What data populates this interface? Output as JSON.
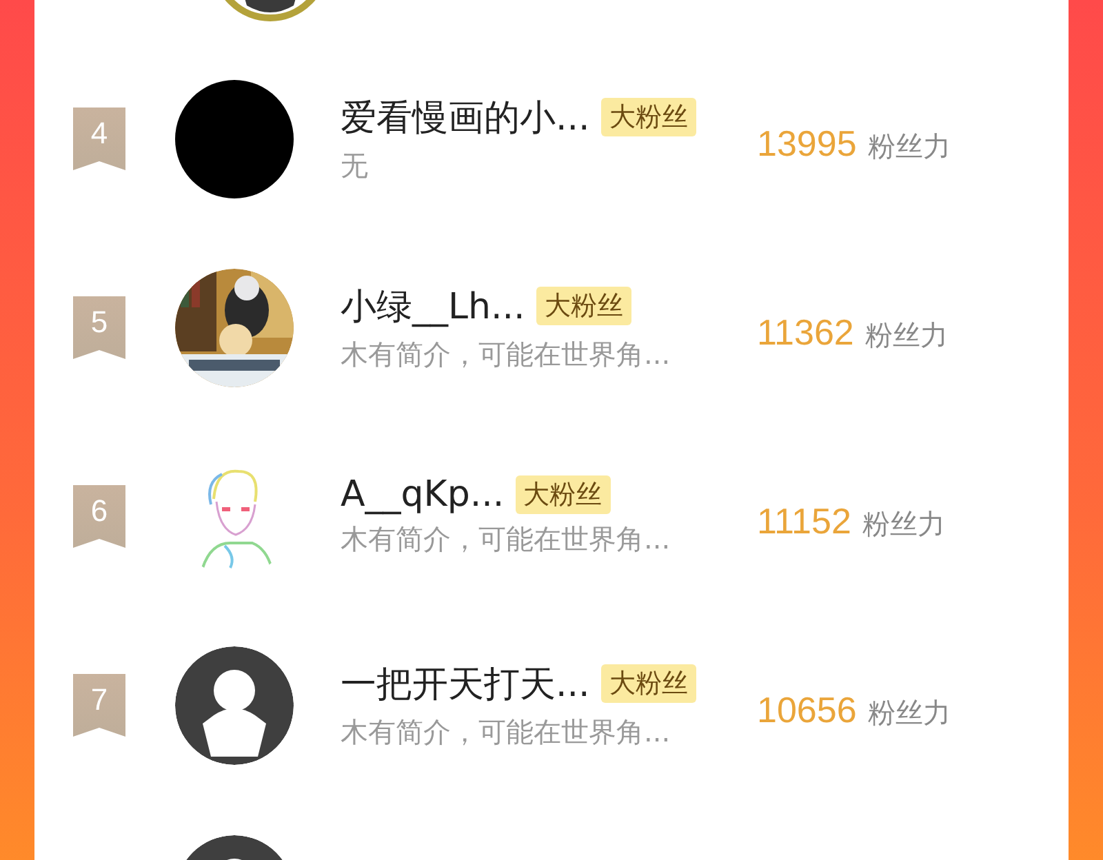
{
  "top_avatar": {
    "kind": "ringed"
  },
  "rows": [
    {
      "rank": "4",
      "avatar": {
        "kind": "blank"
      },
      "name": "爱看慢画的小...",
      "tag": "大粉丝",
      "bio": "无",
      "score": "13995",
      "score_unit": "粉丝力"
    },
    {
      "rank": "5",
      "name": "小绿__Lh...",
      "tag": "大粉丝",
      "bio": "木有简介，可能在世界角...",
      "score": "11362",
      "score_unit": "粉丝力"
    },
    {
      "rank": "6",
      "avatar": {
        "kind": "sketch"
      },
      "name": "A__qKp...",
      "tag": "大粉丝",
      "bio": "木有简介，可能在世界角...",
      "score": "11152",
      "score_unit": "粉丝力"
    },
    {
      "rank": "7",
      "avatar": {
        "kind": "default"
      },
      "name": "一把开天打天...",
      "tag": "大粉丝",
      "bio": "木有简介，可能在世界角...",
      "score": "10656",
      "score_unit": "粉丝力"
    }
  ],
  "next_avatar": {
    "kind": "default"
  }
}
